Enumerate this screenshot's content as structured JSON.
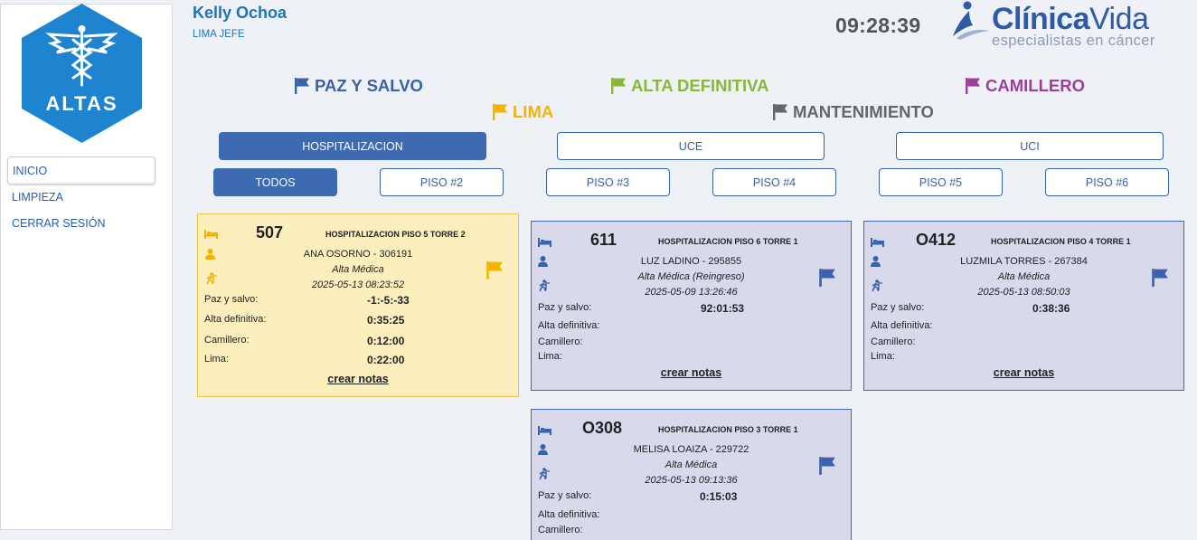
{
  "sidebar": {
    "logo_text": "ALTAS",
    "items": [
      {
        "label": "INICIO",
        "active": true
      },
      {
        "label": "LIMPIEZA",
        "active": false
      },
      {
        "label": "CERRAR SESIÓN",
        "active": false
      }
    ]
  },
  "header": {
    "user_name": "Kelly Ochoa",
    "user_role": "LIMA JEFE",
    "clock": "09:28:39",
    "brand_name_bold": "Clínica",
    "brand_name_light": "Vida",
    "brand_tagline": "especialistas en cáncer"
  },
  "legend": [
    {
      "label": "PAZ Y SALVO",
      "color": "#3b62a6"
    },
    {
      "label": "ALTA DEFINITIVA",
      "color": "#8bb63a"
    },
    {
      "label": "CAMILLERO",
      "color": "#9b3f9b"
    },
    {
      "label": "LIMA",
      "color": "#f2b400"
    },
    {
      "label": "MANTENIMIENTO",
      "color": "#666666"
    }
  ],
  "areas": [
    "HOSPITALIZACION",
    "UCE",
    "UCI"
  ],
  "floors": [
    "TODOS",
    "PISO #2",
    "PISO #3",
    "PISO #4",
    "PISO #5",
    "PISO #6"
  ],
  "cards": [
    {
      "room": "507",
      "location": "HOSPITALIZACION PISO 5 TORRE 2",
      "patient": "ANA OSORNO - 306191",
      "alta": "Alta Médica",
      "date": "2025-05-13 08:23:52",
      "labels": [
        "Paz y salvo:",
        "Alta definitiva:",
        "Camillero:",
        "Lima:"
      ],
      "values": [
        "-1:-5:-33",
        "0:35:25",
        "0:12:00",
        "0:22:00"
      ],
      "notes": "crear notas",
      "flag_color": "#f2b400"
    },
    {
      "room": "611",
      "location": "HOSPITALIZACION PISO 6 TORRE 1",
      "patient": "LUZ LADINO - 295855",
      "alta": "Alta Médica (Reingreso)",
      "date": "2025-05-09 13:26:46",
      "labels": [
        "Paz y salvo:",
        "Alta definitiva:",
        "Camillero:",
        "Lima:"
      ],
      "values": [
        "92:01:53",
        "",
        "",
        ""
      ],
      "notes": "crear notas",
      "flag_color": "#3b62a6"
    },
    {
      "room": "O412",
      "location": "HOSPITALIZACION PISO 4 TORRE 1",
      "patient": "LUZMILA TORRES - 267384",
      "alta": "Alta Médica",
      "date": "2025-05-13 08:50:03",
      "labels": [
        "Paz y salvo:",
        "Alta definitiva:",
        "Camillero:",
        "Lima:"
      ],
      "values": [
        "0:38:36",
        "",
        "",
        ""
      ],
      "notes": "crear notas",
      "flag_color": "#3b62a6"
    },
    {
      "room": "O308",
      "location": "HOSPITALIZACION PISO 3 TORRE 1",
      "patient": "MELISA LOAIZA - 229722",
      "alta": "Alta Médica",
      "date": "2025-05-13 09:13:36",
      "labels": [
        "Paz y salvo:",
        "Alta definitiva:",
        "Camillero:"
      ],
      "values": [
        "0:15:03",
        "",
        ""
      ],
      "notes": "",
      "flag_color": "#3b62a6"
    }
  ],
  "colors": {
    "primary": "#3d6ab0",
    "card_bg": "#d8daec",
    "card_alert_bg": "#fcefbd"
  }
}
